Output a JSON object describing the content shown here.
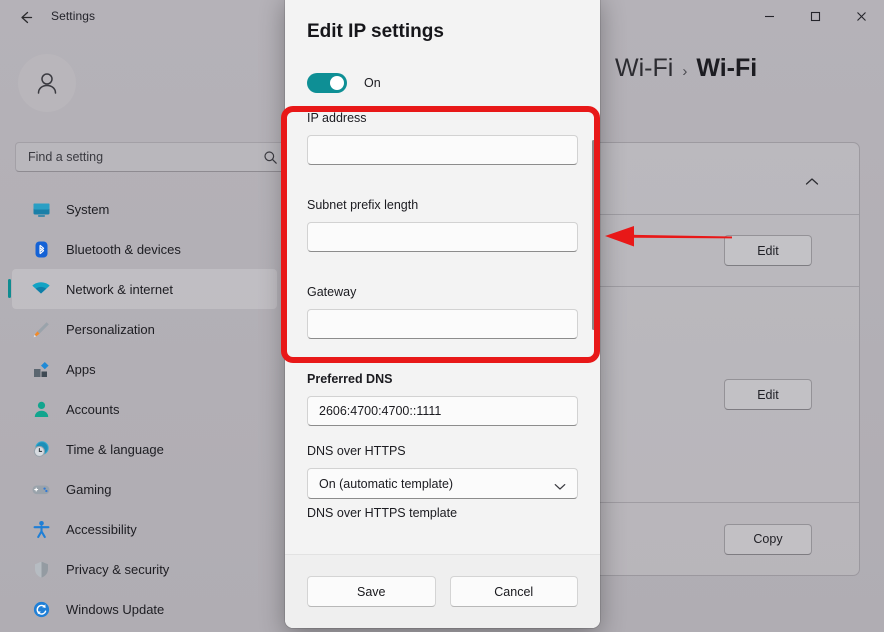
{
  "window": {
    "app_title": "Settings",
    "back_icon": "back-arrow-icon",
    "controls": {
      "minimize": "minimize-icon",
      "maximize": "maximize-icon",
      "close": "close-icon"
    }
  },
  "sidebar": {
    "avatar_icon": "user-avatar-icon",
    "search": {
      "placeholder": "Find a setting",
      "value": "",
      "icon": "search-icon"
    },
    "items": [
      {
        "label": "System",
        "icon": "monitor-icon",
        "selected": false
      },
      {
        "label": "Bluetooth & devices",
        "icon": "bluetooth-icon",
        "selected": false
      },
      {
        "label": "Network & internet",
        "icon": "wifi-icon",
        "selected": true
      },
      {
        "label": "Personalization",
        "icon": "paintbrush-icon",
        "selected": false
      },
      {
        "label": "Apps",
        "icon": "apps-icon",
        "selected": false
      },
      {
        "label": "Accounts",
        "icon": "person-icon",
        "selected": false
      },
      {
        "label": "Time & language",
        "icon": "clock-globe-icon",
        "selected": false
      },
      {
        "label": "Gaming",
        "icon": "gamepad-icon",
        "selected": false
      },
      {
        "label": "Accessibility",
        "icon": "accessibility-icon",
        "selected": false
      },
      {
        "label": "Privacy & security",
        "icon": "shield-icon",
        "selected": false
      },
      {
        "label": "Windows Update",
        "icon": "update-refresh-icon",
        "selected": false
      }
    ]
  },
  "content": {
    "breadcrumb": {
      "parent": "Wi-Fi",
      "separator": "›",
      "current": "Wi-Fi"
    },
    "collapse_icon": "chevron-up-icon",
    "rows": [
      {
        "button": ""
      },
      {
        "button": "Edit"
      },
      {
        "button": "Edit"
      },
      {
        "button": "Copy"
      }
    ]
  },
  "dialog": {
    "title": "Edit IP settings",
    "toggle": {
      "state": "On",
      "on": true
    },
    "fields": {
      "ip_address": {
        "label": "IP address",
        "value": "",
        "placeholder": ""
      },
      "subnet_prefix": {
        "label": "Subnet prefix length",
        "value": "",
        "placeholder": ""
      },
      "gateway": {
        "label": "Gateway",
        "value": "",
        "placeholder": ""
      },
      "preferred_dns": {
        "label": "Preferred DNS",
        "value": "2606:4700:4700::1111",
        "placeholder": ""
      },
      "dns_over_https": {
        "label": "DNS over HTTPS",
        "value": "On (automatic template)",
        "chevron": "chevron-down-icon"
      },
      "dns_over_https_template": {
        "label": "DNS over HTTPS template"
      }
    },
    "footer": {
      "save": "Save",
      "cancel": "Cancel"
    }
  },
  "annotations": {
    "highlight_color": "#e81818",
    "arrow_color": "#e81818",
    "highlight_target": "ip-subnet-gateway-fields",
    "arrow_target": "edit-button-row-1"
  }
}
